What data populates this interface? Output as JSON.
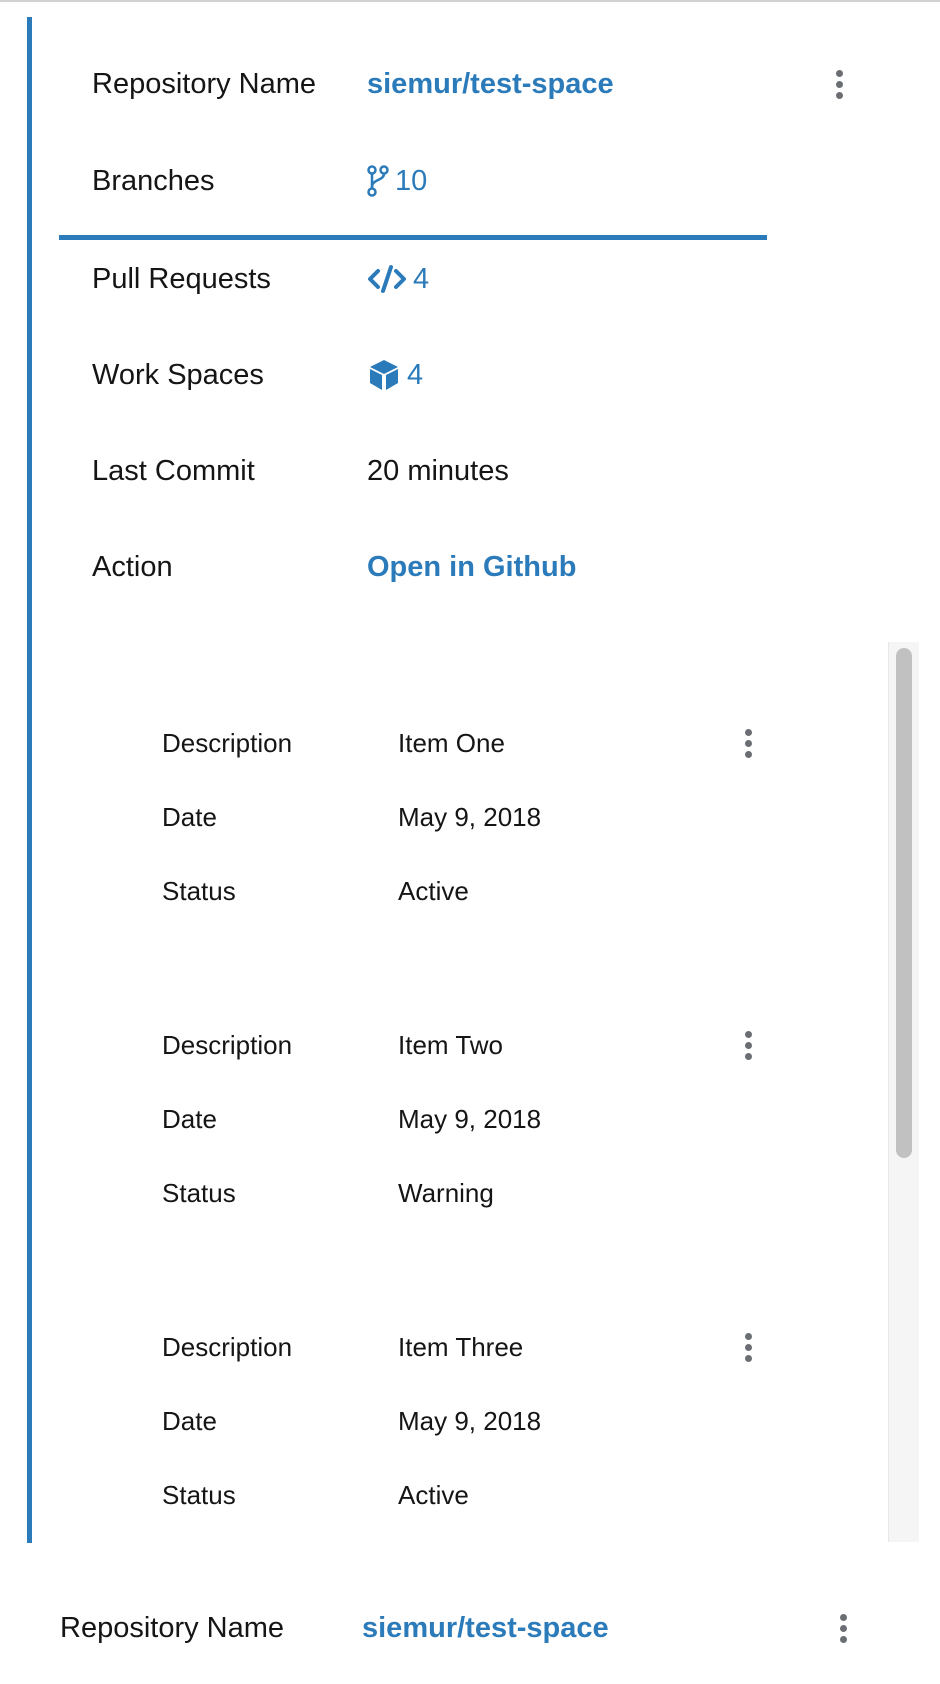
{
  "colors": {
    "accent": "#2b7bba",
    "text": "#151515",
    "kebab": "#6a6e73",
    "border": "#d2d2d2"
  },
  "expanded_row": {
    "fields": {
      "repository_name": {
        "label": "Repository Name",
        "value": "siemur/test-space"
      },
      "branches": {
        "label": "Branches",
        "value": "10",
        "icon": "code-branch-icon"
      },
      "pull_requests": {
        "label": "Pull Requests",
        "value": "4",
        "icon": "code-icon"
      },
      "work_spaces": {
        "label": "Work Spaces",
        "value": "4",
        "icon": "cube-icon"
      },
      "last_commit": {
        "label": "Last Commit",
        "value": "20 minutes"
      },
      "action": {
        "label": "Action",
        "value": "Open in Github"
      }
    },
    "nested_items": [
      {
        "description_label": "Description",
        "description": "Item One",
        "date_label": "Date",
        "date": "May 9, 2018",
        "status_label": "Status",
        "status": "Active"
      },
      {
        "description_label": "Description",
        "description": "Item Two",
        "date_label": "Date",
        "date": "May 9, 2018",
        "status_label": "Status",
        "status": "Warning"
      },
      {
        "description_label": "Description",
        "description": "Item Three",
        "date_label": "Date",
        "date": "May 9, 2018",
        "status_label": "Status",
        "status": "Active"
      }
    ]
  },
  "next_row": {
    "repository_name": {
      "label": "Repository Name",
      "value": "siemur/test-space"
    }
  }
}
